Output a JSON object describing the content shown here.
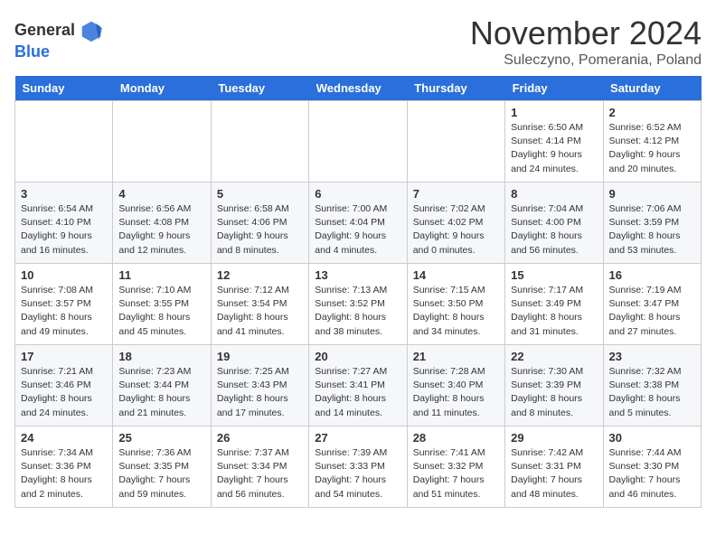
{
  "header": {
    "logo_general": "General",
    "logo_blue": "Blue",
    "month_title": "November 2024",
    "location": "Suleczyno, Pomerania, Poland"
  },
  "weekdays": [
    "Sunday",
    "Monday",
    "Tuesday",
    "Wednesday",
    "Thursday",
    "Friday",
    "Saturday"
  ],
  "weeks": [
    [
      {
        "day": "",
        "info": ""
      },
      {
        "day": "",
        "info": ""
      },
      {
        "day": "",
        "info": ""
      },
      {
        "day": "",
        "info": ""
      },
      {
        "day": "",
        "info": ""
      },
      {
        "day": "1",
        "info": "Sunrise: 6:50 AM\nSunset: 4:14 PM\nDaylight: 9 hours and 24 minutes."
      },
      {
        "day": "2",
        "info": "Sunrise: 6:52 AM\nSunset: 4:12 PM\nDaylight: 9 hours and 20 minutes."
      }
    ],
    [
      {
        "day": "3",
        "info": "Sunrise: 6:54 AM\nSunset: 4:10 PM\nDaylight: 9 hours and 16 minutes."
      },
      {
        "day": "4",
        "info": "Sunrise: 6:56 AM\nSunset: 4:08 PM\nDaylight: 9 hours and 12 minutes."
      },
      {
        "day": "5",
        "info": "Sunrise: 6:58 AM\nSunset: 4:06 PM\nDaylight: 9 hours and 8 minutes."
      },
      {
        "day": "6",
        "info": "Sunrise: 7:00 AM\nSunset: 4:04 PM\nDaylight: 9 hours and 4 minutes."
      },
      {
        "day": "7",
        "info": "Sunrise: 7:02 AM\nSunset: 4:02 PM\nDaylight: 9 hours and 0 minutes."
      },
      {
        "day": "8",
        "info": "Sunrise: 7:04 AM\nSunset: 4:00 PM\nDaylight: 8 hours and 56 minutes."
      },
      {
        "day": "9",
        "info": "Sunrise: 7:06 AM\nSunset: 3:59 PM\nDaylight: 8 hours and 53 minutes."
      }
    ],
    [
      {
        "day": "10",
        "info": "Sunrise: 7:08 AM\nSunset: 3:57 PM\nDaylight: 8 hours and 49 minutes."
      },
      {
        "day": "11",
        "info": "Sunrise: 7:10 AM\nSunset: 3:55 PM\nDaylight: 8 hours and 45 minutes."
      },
      {
        "day": "12",
        "info": "Sunrise: 7:12 AM\nSunset: 3:54 PM\nDaylight: 8 hours and 41 minutes."
      },
      {
        "day": "13",
        "info": "Sunrise: 7:13 AM\nSunset: 3:52 PM\nDaylight: 8 hours and 38 minutes."
      },
      {
        "day": "14",
        "info": "Sunrise: 7:15 AM\nSunset: 3:50 PM\nDaylight: 8 hours and 34 minutes."
      },
      {
        "day": "15",
        "info": "Sunrise: 7:17 AM\nSunset: 3:49 PM\nDaylight: 8 hours and 31 minutes."
      },
      {
        "day": "16",
        "info": "Sunrise: 7:19 AM\nSunset: 3:47 PM\nDaylight: 8 hours and 27 minutes."
      }
    ],
    [
      {
        "day": "17",
        "info": "Sunrise: 7:21 AM\nSunset: 3:46 PM\nDaylight: 8 hours and 24 minutes."
      },
      {
        "day": "18",
        "info": "Sunrise: 7:23 AM\nSunset: 3:44 PM\nDaylight: 8 hours and 21 minutes."
      },
      {
        "day": "19",
        "info": "Sunrise: 7:25 AM\nSunset: 3:43 PM\nDaylight: 8 hours and 17 minutes."
      },
      {
        "day": "20",
        "info": "Sunrise: 7:27 AM\nSunset: 3:41 PM\nDaylight: 8 hours and 14 minutes."
      },
      {
        "day": "21",
        "info": "Sunrise: 7:28 AM\nSunset: 3:40 PM\nDaylight: 8 hours and 11 minutes."
      },
      {
        "day": "22",
        "info": "Sunrise: 7:30 AM\nSunset: 3:39 PM\nDaylight: 8 hours and 8 minutes."
      },
      {
        "day": "23",
        "info": "Sunrise: 7:32 AM\nSunset: 3:38 PM\nDaylight: 8 hours and 5 minutes."
      }
    ],
    [
      {
        "day": "24",
        "info": "Sunrise: 7:34 AM\nSunset: 3:36 PM\nDaylight: 8 hours and 2 minutes."
      },
      {
        "day": "25",
        "info": "Sunrise: 7:36 AM\nSunset: 3:35 PM\nDaylight: 7 hours and 59 minutes."
      },
      {
        "day": "26",
        "info": "Sunrise: 7:37 AM\nSunset: 3:34 PM\nDaylight: 7 hours and 56 minutes."
      },
      {
        "day": "27",
        "info": "Sunrise: 7:39 AM\nSunset: 3:33 PM\nDaylight: 7 hours and 54 minutes."
      },
      {
        "day": "28",
        "info": "Sunrise: 7:41 AM\nSunset: 3:32 PM\nDaylight: 7 hours and 51 minutes."
      },
      {
        "day": "29",
        "info": "Sunrise: 7:42 AM\nSunset: 3:31 PM\nDaylight: 7 hours and 48 minutes."
      },
      {
        "day": "30",
        "info": "Sunrise: 7:44 AM\nSunset: 3:30 PM\nDaylight: 7 hours and 46 minutes."
      }
    ]
  ]
}
